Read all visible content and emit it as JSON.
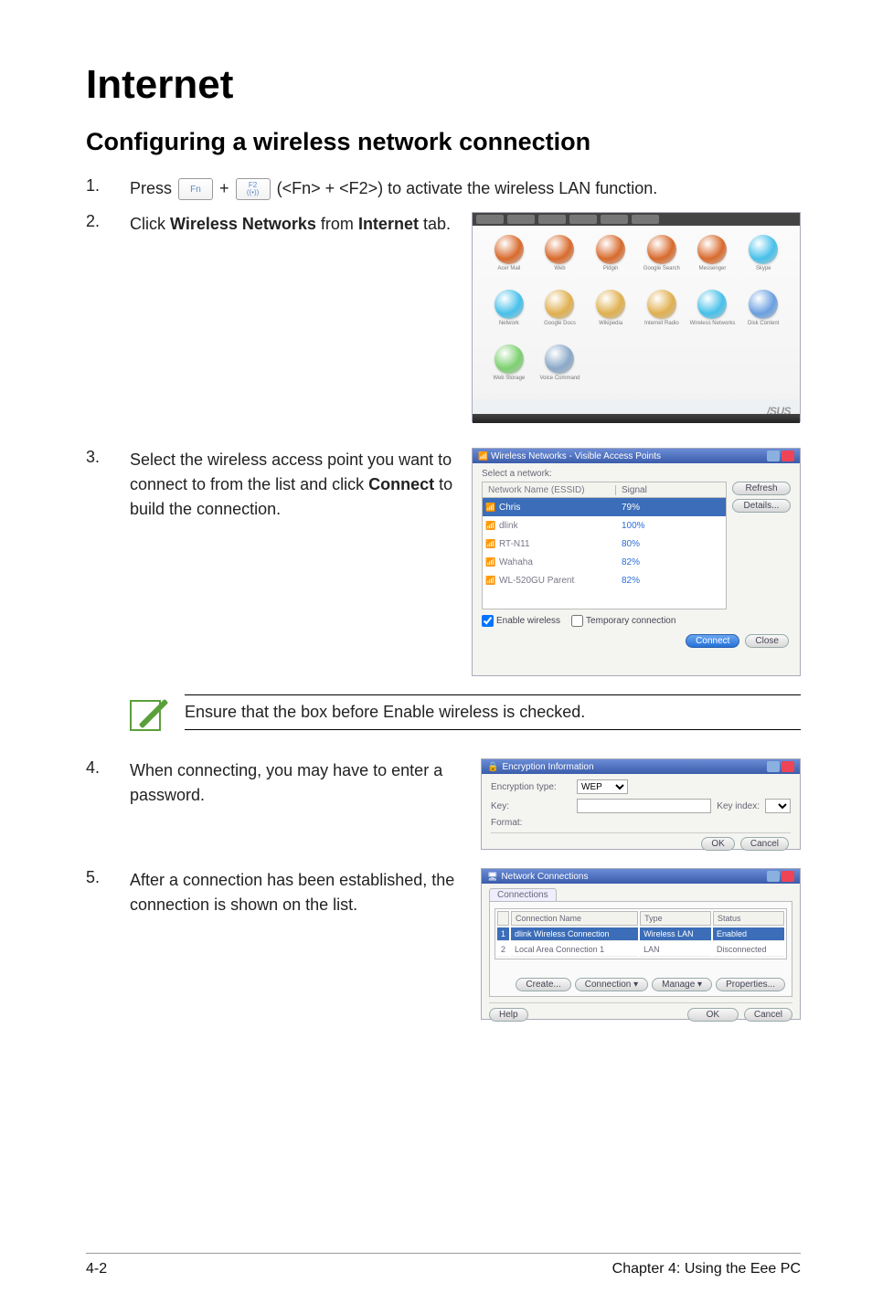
{
  "title": "Internet",
  "subtitle": "Configuring a wireless network connection",
  "step1": {
    "num": "1.",
    "pre": "Press ",
    "key1": "Fn",
    "plus": "+",
    "key2_top": "F2",
    "key2_bottom": "((•))",
    "post": " (<Fn> + <F2>) to activate the wireless LAN function."
  },
  "step2": {
    "num": "2.",
    "a": "Click ",
    "b1": "Wireless Networks",
    "c": " from ",
    "b2": "Internet",
    "d": " tab."
  },
  "step3": {
    "num": "3.",
    "a": "Select the wireless access point you want to connect to from the list and click ",
    "b": "Connect",
    "c": " to build the connection."
  },
  "note": {
    "a": "Ensure that the box before ",
    "b": "Enable wireless",
    "c": " is checked."
  },
  "step4": {
    "num": "4.",
    "text": "When connecting, you may have to enter a password."
  },
  "step5": {
    "num": "5.",
    "text": "After a connection has been established, the connection is shown on the list."
  },
  "desk": {
    "brand": "/SUS",
    "icons": [
      {
        "label": "Acer Mail",
        "c": "#d86a2c"
      },
      {
        "label": "Web",
        "c": "#d86a2c"
      },
      {
        "label": "Pidgin",
        "c": "#d86a2c"
      },
      {
        "label": "Google Search",
        "c": "#d86a2c"
      },
      {
        "label": "Messenger",
        "c": "#d86a2c"
      },
      {
        "label": "Skype",
        "c": "#47c0ea"
      },
      {
        "label": "Network",
        "c": "#47c0ea"
      },
      {
        "label": "Google Docs",
        "c": "#e0b050"
      },
      {
        "label": "Wikipedia",
        "c": "#e0b050"
      },
      {
        "label": "Internet Radio",
        "c": "#e0b050"
      },
      {
        "label": "Wireless Networks",
        "c": "#47c0ea"
      },
      {
        "label": "Disk Content",
        "c": "#6a9fe0"
      },
      {
        "label": "Web Storage",
        "c": "#7cd070"
      },
      {
        "label": "Voice Command",
        "c": "#8aa8c8"
      }
    ]
  },
  "wireless": {
    "title": "Wireless Networks - Visible Access Points",
    "label": "Select a network:",
    "hdr_name": "Network Name (ESSID)",
    "hdr_sig": "Signal",
    "rows": [
      {
        "name": "Chris",
        "sig": "79%",
        "sel": true
      },
      {
        "name": "dlink",
        "sig": "100%"
      },
      {
        "name": "RT-N11",
        "sig": "80%"
      },
      {
        "name": "Wahaha",
        "sig": "82%"
      },
      {
        "name": "WL-520GU Parent",
        "sig": "82%"
      }
    ],
    "refresh": "Refresh",
    "details": "Details...",
    "enable": "Enable wireless",
    "temp": "Temporary connection",
    "connect": "Connect",
    "close": "Close"
  },
  "enc": {
    "title": "Encryption Information",
    "type_lab": "Encryption type:",
    "type_val": "WEP",
    "key_lab": "Key:",
    "key_index_lab": "Key index:",
    "format_lab": "Format:",
    "ok": "OK",
    "cancel": "Cancel"
  },
  "conn": {
    "title": "Network Connections",
    "tab": "Connections",
    "hdr_name": "Connection Name",
    "hdr_type": "Type",
    "hdr_status": "Status",
    "rows": [
      {
        "idx": "1",
        "name": "dlink Wireless Connection",
        "type": "Wireless LAN",
        "status": "Enabled",
        "sel": true
      },
      {
        "idx": "2",
        "name": "Local Area Connection 1",
        "type": "LAN",
        "status": "Disconnected"
      }
    ],
    "create": "Create...",
    "connection": "Connection ▾",
    "manage": "Manage ▾",
    "properties": "Properties...",
    "help": "Help",
    "ok": "OK",
    "cancel": "Cancel"
  },
  "footer": {
    "left": "4-2",
    "right": "Chapter 4: Using the Eee PC"
  }
}
